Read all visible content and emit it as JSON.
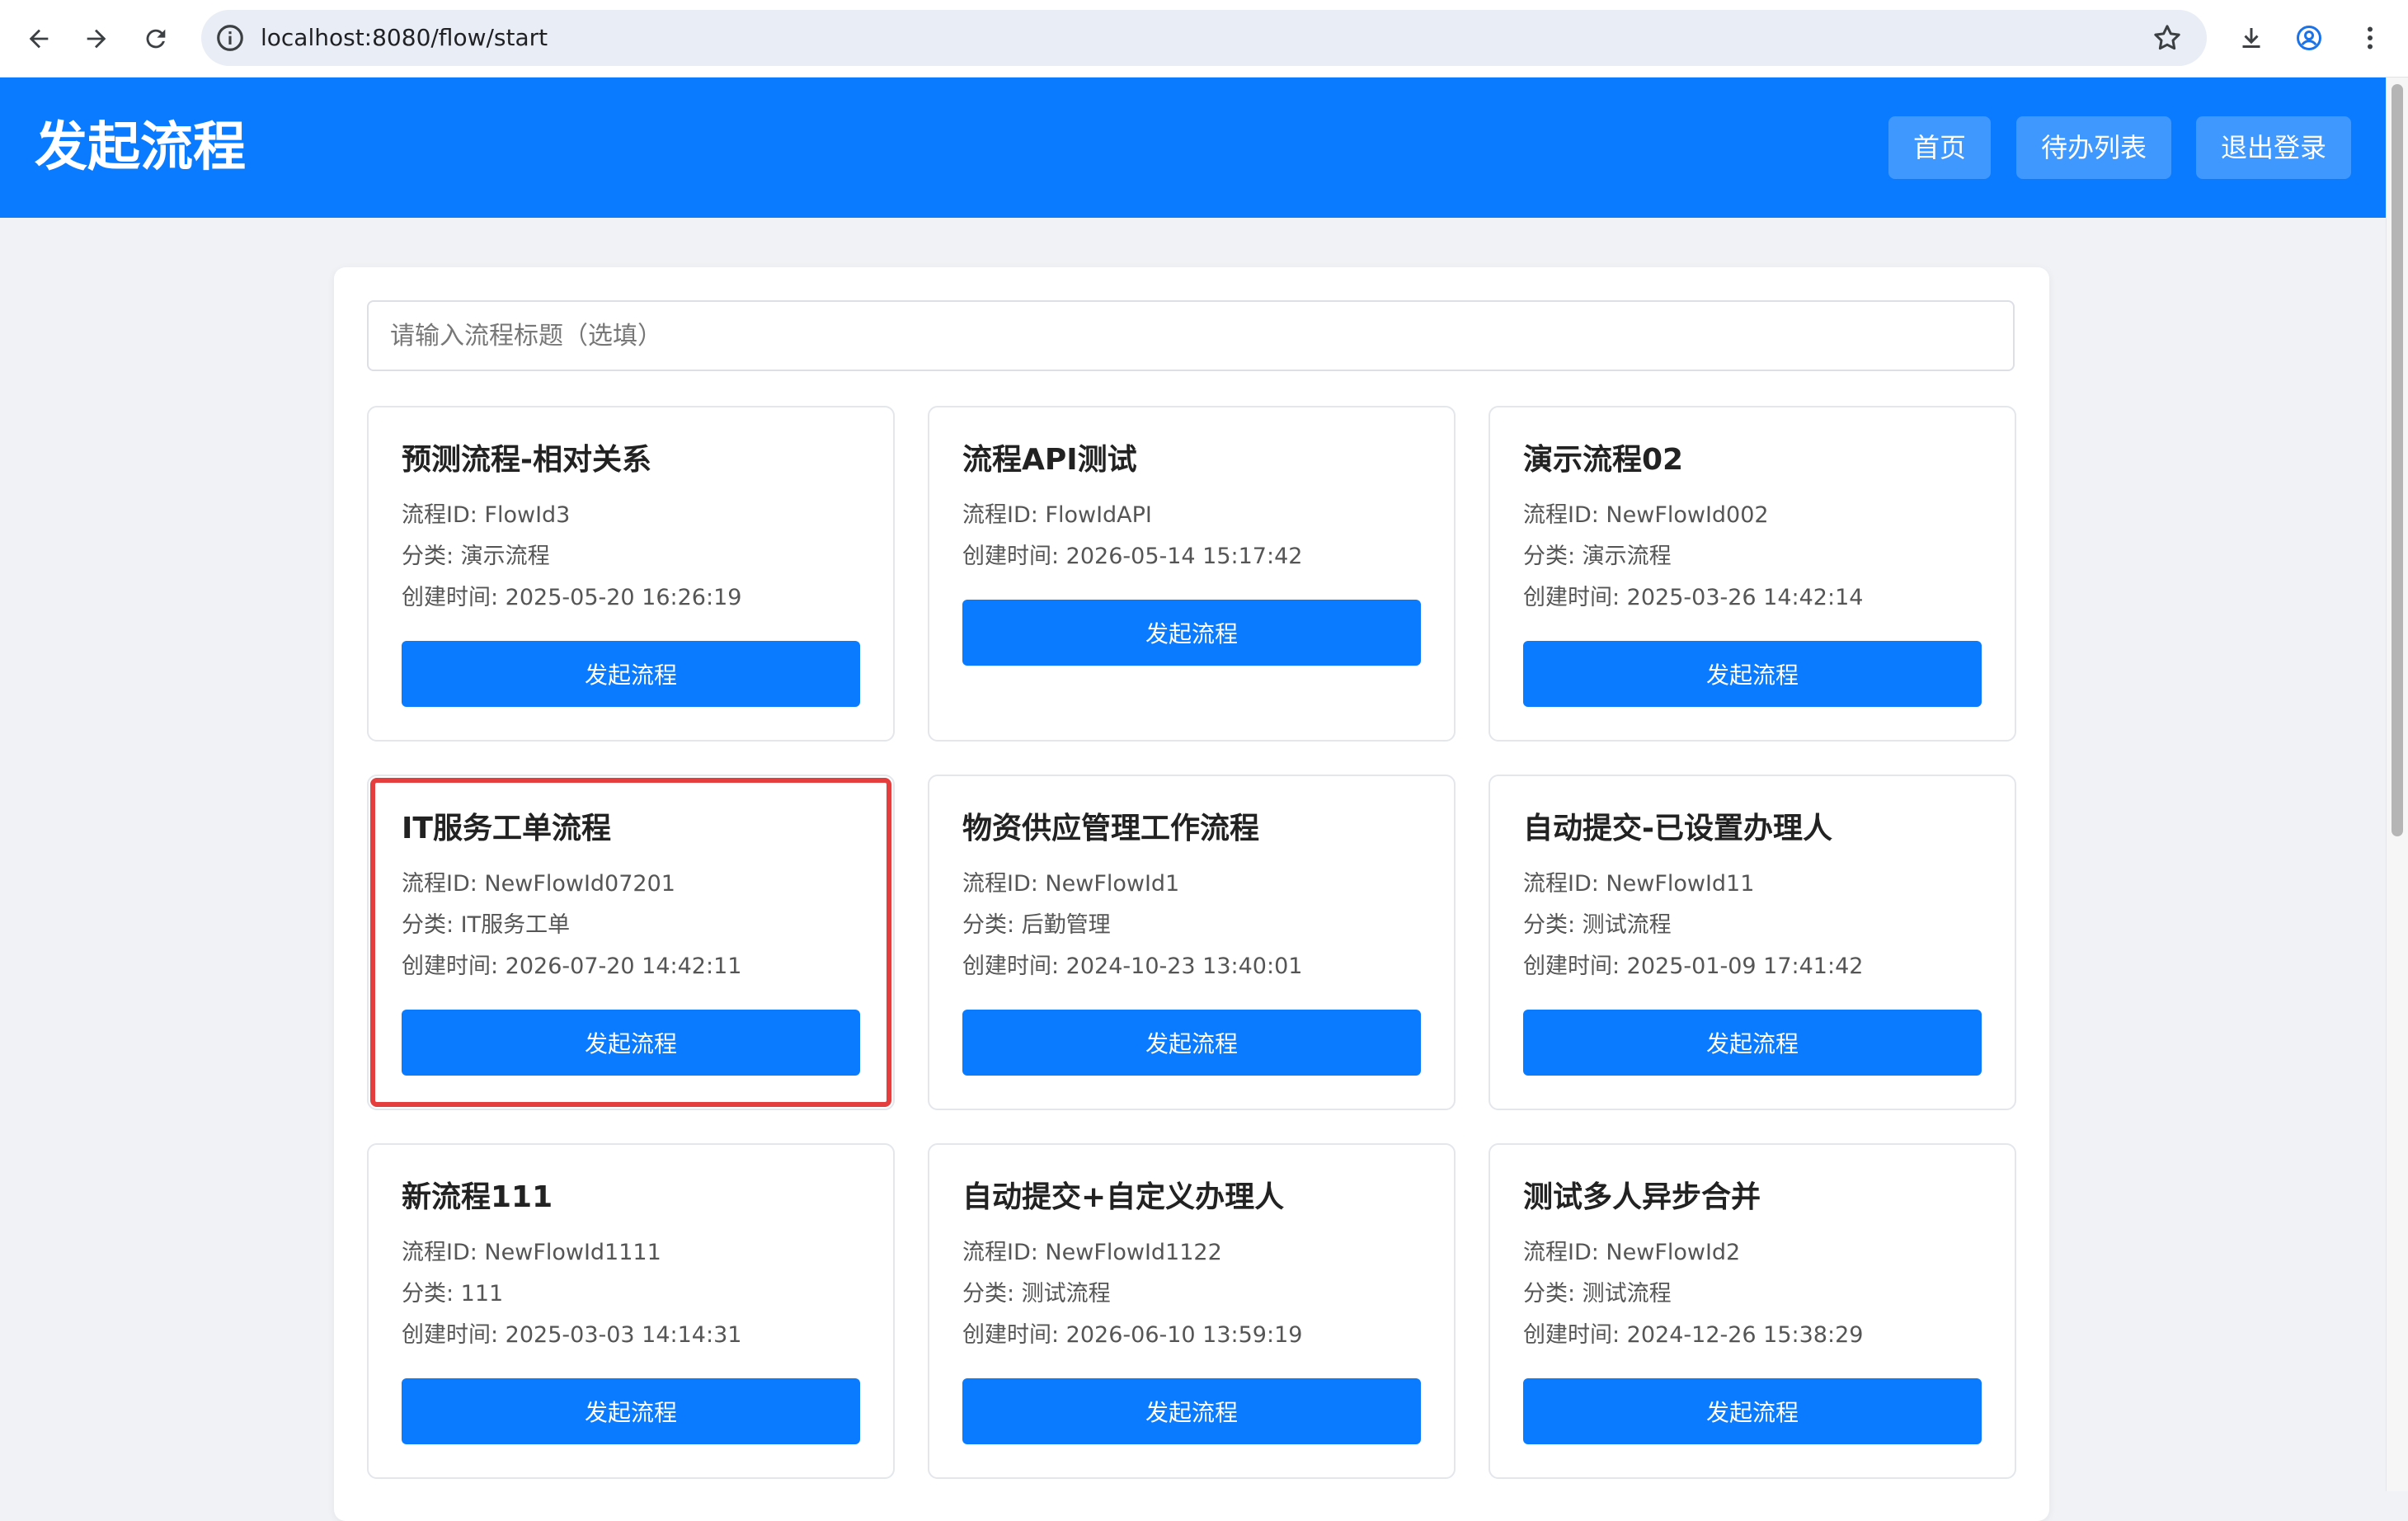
{
  "browser": {
    "url": "localhost:8080/flow/start"
  },
  "header": {
    "title": "发起流程",
    "nav": {
      "home": "首页",
      "todo": "待办列表",
      "logout": "退出登录"
    }
  },
  "search": {
    "placeholder": "请输入流程标题（选填）"
  },
  "labels": {
    "flow_id": "流程ID: ",
    "category": "分类: ",
    "created": "创建时间: ",
    "start_button": "发起流程"
  },
  "flows": [
    {
      "title": "预测流程-相对关系",
      "id_line": "流程ID: FlowId3",
      "category_line": "分类: 演示流程",
      "created_line": "创建时间: 2025-05-20 16:26:19",
      "button": "发起流程"
    },
    {
      "title": "流程API测试",
      "id_line": "流程ID: FlowIdAPI",
      "category_line": "",
      "created_line": "创建时间: 2026-05-14 15:17:42",
      "button": "发起流程"
    },
    {
      "title": "演示流程02",
      "id_line": "流程ID: NewFlowId002",
      "category_line": "分类: 演示流程",
      "created_line": "创建时间: 2025-03-26 14:42:14",
      "button": "发起流程"
    },
    {
      "title": "IT服务工单流程",
      "id_line": "流程ID: NewFlowId07201",
      "category_line": "分类: IT服务工单",
      "created_line": "创建时间: 2026-07-20 14:42:11",
      "button": "发起流程"
    },
    {
      "title": "物资供应管理工作流程",
      "id_line": "流程ID: NewFlowId1",
      "category_line": "分类: 后勤管理",
      "created_line": "创建时间: 2024-10-23 13:40:01",
      "button": "发起流程"
    },
    {
      "title": "自动提交-已设置办理人",
      "id_line": "流程ID: NewFlowId11",
      "category_line": "分类: 测试流程",
      "created_line": "创建时间: 2025-01-09 17:41:42",
      "button": "发起流程"
    },
    {
      "title": "新流程111",
      "id_line": "流程ID: NewFlowId1111",
      "category_line": "分类: 111",
      "created_line": "创建时间: 2025-03-03 14:14:31",
      "button": "发起流程"
    },
    {
      "title": "自动提交+自定义办理人",
      "id_line": "流程ID: NewFlowId1122",
      "category_line": "分类: 测试流程",
      "created_line": "创建时间: 2026-06-10 13:59:19",
      "button": "发起流程"
    },
    {
      "title": "测试多人异步合并",
      "id_line": "流程ID: NewFlowId2",
      "category_line": "分类: 测试流程",
      "created_line": "创建时间: 2024-12-26 15:38:29",
      "button": "发起流程"
    }
  ],
  "highlight_color": "#e53e3e",
  "accent_color": "#0a7bfe"
}
